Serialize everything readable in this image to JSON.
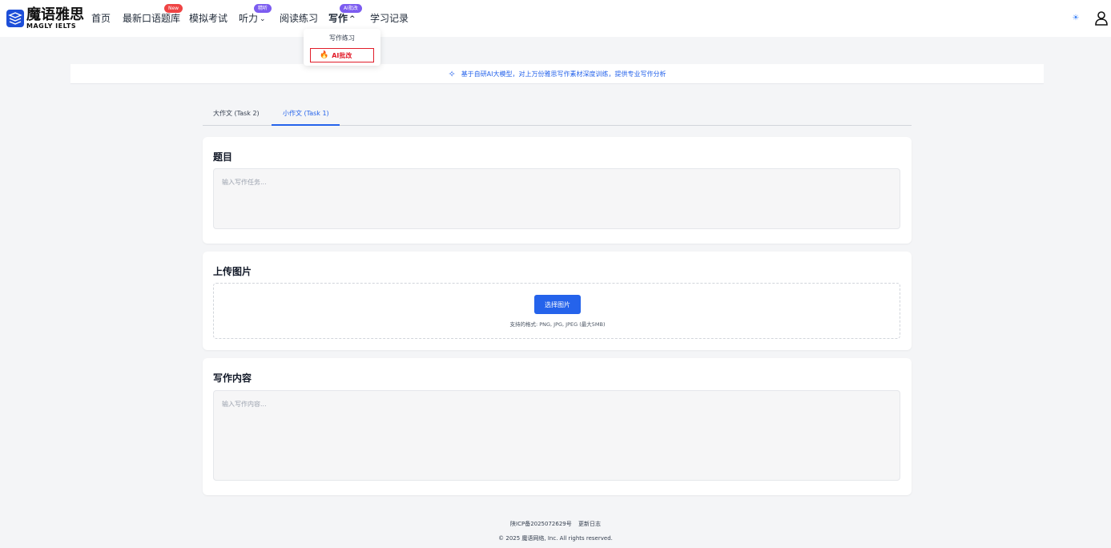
{
  "brand": {
    "name_cn": "魔语雅思",
    "name_en": "MAGLY IELTS"
  },
  "nav": {
    "items": [
      {
        "label": "首页"
      },
      {
        "label": "最新口语题库",
        "badge": "New"
      },
      {
        "label": "模拟考试"
      },
      {
        "label": "听力",
        "badge": "精听"
      },
      {
        "label": "阅读练习"
      },
      {
        "label": "写作",
        "badge": "AI批改"
      },
      {
        "label": "学习记录"
      }
    ],
    "dropdown": {
      "item1": "写作练习",
      "item2": "AI批改"
    }
  },
  "banner": {
    "text": "基于自研AI大模型，对上万份雅思写作素材深度训练，提供专业写作分析"
  },
  "tabs": [
    {
      "label": "大作文 (Task 2)"
    },
    {
      "label": "小作文 (Task 1)"
    }
  ],
  "topic": {
    "title": "题目",
    "placeholder": "输入写作任务..."
  },
  "upload": {
    "title": "上传图片",
    "button": "选择图片",
    "hint": "支持的格式: PNG, JPG, JPEG (最大5MB)"
  },
  "content": {
    "title": "写作内容",
    "placeholder": "输入写作内容..."
  },
  "footer": {
    "icp": "陕ICP备2025072629号",
    "changelog": "更新日志",
    "copyright": "© 2025 魔语网络, Inc. All rights reserved."
  },
  "colors": {
    "accent": "#2563eb",
    "badge_red": "#ef4444",
    "badge_purple": "#7c5cf0",
    "highlight": "#e11d2a"
  }
}
